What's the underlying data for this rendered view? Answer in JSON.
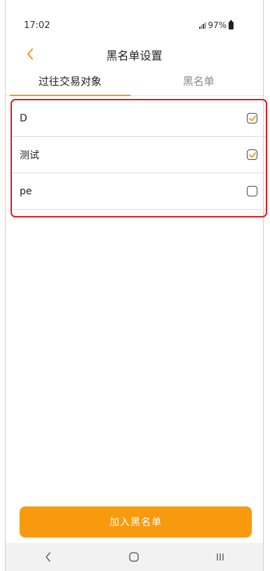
{
  "status_bar": {
    "time": "17:02",
    "battery": "97%"
  },
  "header": {
    "title": "黑名单设置",
    "back_icon": "chevron-left-icon",
    "accent": "#f39a1a"
  },
  "tabs": [
    {
      "label": "过往交易对象",
      "active": true
    },
    {
      "label": "黑名单",
      "active": false
    }
  ],
  "list": {
    "items": [
      {
        "label": "D",
        "checked": true
      },
      {
        "label": "测试",
        "checked": true
      },
      {
        "label": "pe",
        "checked": false
      }
    ],
    "highlight_color": "#e01b24"
  },
  "action": {
    "add_label": "加入黑名单",
    "color": "#f79a0e"
  },
  "nav_bar": {
    "icons": [
      "back-nav-icon",
      "home-nav-icon",
      "recents-nav-icon"
    ]
  }
}
